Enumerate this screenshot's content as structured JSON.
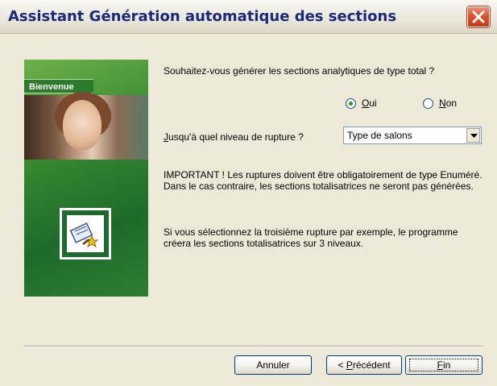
{
  "window": {
    "title": "Assistant Génération automatique des sections"
  },
  "sidebar": {
    "banner_label": "Bienvenue"
  },
  "form": {
    "question": "Souhaitez-vous générer les sections analytiques de type total ?",
    "radio_yes": {
      "label_first": "O",
      "label_rest": "ui",
      "selected": true
    },
    "radio_no": {
      "label_first": "N",
      "label_rest": "on",
      "selected": false
    },
    "level_label_first": "J",
    "level_label_rest": "usqu'à quel niveau de rupture ?",
    "level_select_value": "Type de salons",
    "important_text": "IMPORTANT ! Les ruptures doivent être obligatoirement de type Enuméré. Dans le cas contraire, les sections totalisatrices ne seront pas  générées.",
    "example_text": "Si vous sélectionnez la troisième rupture par exemple, le programme créera les sections totalisatrices sur 3 niveaux."
  },
  "buttons": {
    "cancel": "Annuler",
    "previous_prefix": "< ",
    "previous_first": "P",
    "previous_rest": "récédent",
    "finish_first": "F",
    "finish_rest": "in"
  },
  "colors": {
    "title_text": "#1a2a78",
    "close_button": "#e0502c",
    "panel_green": "#2f7d33",
    "radio_dot": "#21a121"
  }
}
